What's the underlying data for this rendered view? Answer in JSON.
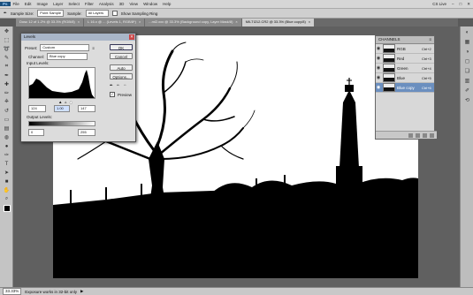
{
  "menu": [
    "Ps",
    "File",
    "Edit",
    "Image",
    "Layer",
    "Select",
    "Filter",
    "Analysis",
    "3D",
    "View",
    "Window",
    "Help"
  ],
  "options_bar": {
    "sample_size_label": "Sample Size:",
    "sample_size_value": "Point Sample",
    "sample_label": "Sample:",
    "sample_value": "All Layers",
    "show_ring_label": "Show Sampling Ring",
    "workspace_label": "CS Live"
  },
  "tabs": [
    {
      "label": "Dosc 12 of 1.2% @ 33.3% (RGB/8)",
      "active": false
    },
    {
      "label": "L 16.x @ ... (Levels 1, RGB/8*)",
      "active": false
    },
    {
      "label": "...ml2.xxx @ 33.3% (Background copy, Layer Mask/8)",
      "active": false
    },
    {
      "label": "MILTI212.CR2 @ 33.3% (Blue copy/8)",
      "active": true
    }
  ],
  "statusbar": {
    "zoom": "33.33%",
    "info": "Exposure works in 32-bit only"
  },
  "levels": {
    "title": "Levels",
    "preset_label": "Preset:",
    "preset_value": "Custom",
    "channel_label": "Channel:",
    "channel_value": "Blue copy",
    "input_label": "Input Levels:",
    "input_black": "124",
    "input_mid": "1.00",
    "input_white": "147",
    "output_label": "Output Levels:",
    "output_black": "0",
    "output_white": "255",
    "ok": "OK",
    "cancel": "Cancel",
    "auto": "Auto",
    "options": "Options...",
    "preview": "Preview"
  },
  "channels": {
    "title": "CHANNELS",
    "rows": [
      {
        "name": "RGB",
        "shortcut": "Ctrl+2",
        "selected": false
      },
      {
        "name": "Red",
        "shortcut": "Ctrl+3",
        "selected": false
      },
      {
        "name": "Green",
        "shortcut": "Ctrl+4",
        "selected": false
      },
      {
        "name": "Blue",
        "shortcut": "Ctrl+5",
        "selected": false
      },
      {
        "name": "Blue copy",
        "shortcut": "Ctrl+6",
        "selected": true
      }
    ]
  },
  "colors": {
    "ui_gray": "#cfcfcf",
    "selection_blue": "#6b8fbf",
    "canvas_bg": "#606060"
  }
}
